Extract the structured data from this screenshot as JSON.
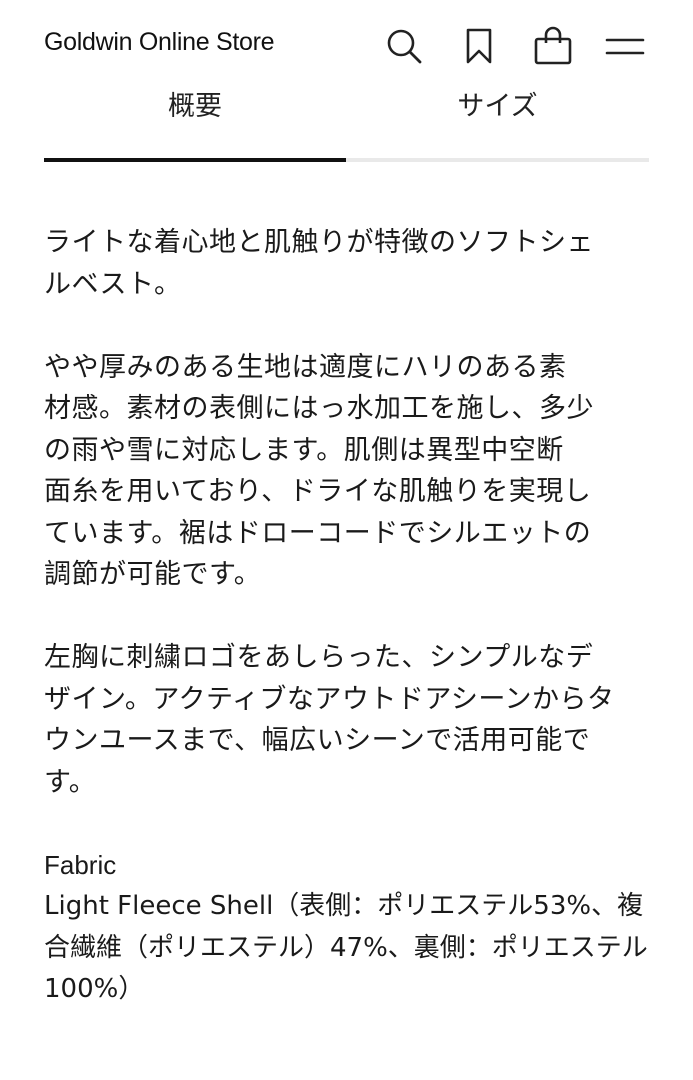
{
  "header": {
    "brand": "Goldwin Online Store",
    "icons": [
      "search-icon",
      "bookmark-icon",
      "bag-icon",
      "menu-icon"
    ]
  },
  "tabs": [
    {
      "label": "概要",
      "active": true
    },
    {
      "label": "サイズ",
      "active": false
    }
  ],
  "description": {
    "paragraphs": [
      "ライトな着心地と肌触りが特徴のソフトシェ\nルベスト。",
      "やや厚みのある生地は適度にハリのある素\n材感。素材の表側にはっ水加工を施し、多少\nの雨や雪に対応します。肌側は異型中空断\n面糸を用いており、ドライな肌触りを実現し\nています。裾はドローコードでシルエットの\n調節が可能です。",
      "左胸に刺繍ロゴをあしらった、シンプルなデ\nザイン。アクティブなアウトドアシーンからタ\nウンユースまで、幅広いシーンで活用可能で\nす。"
    ]
  },
  "fabric": {
    "heading": "Fabric",
    "text": "Light Fleece Shell（表側：ポリエステル53%、複\n合繊維（ポリエステル）47%、裏側：ポリエステル\n100%）"
  },
  "colors": {
    "text": "#1a1a1a",
    "tab_active_line": "#111111",
    "tab_inactive_line": "#e9e9e9"
  }
}
